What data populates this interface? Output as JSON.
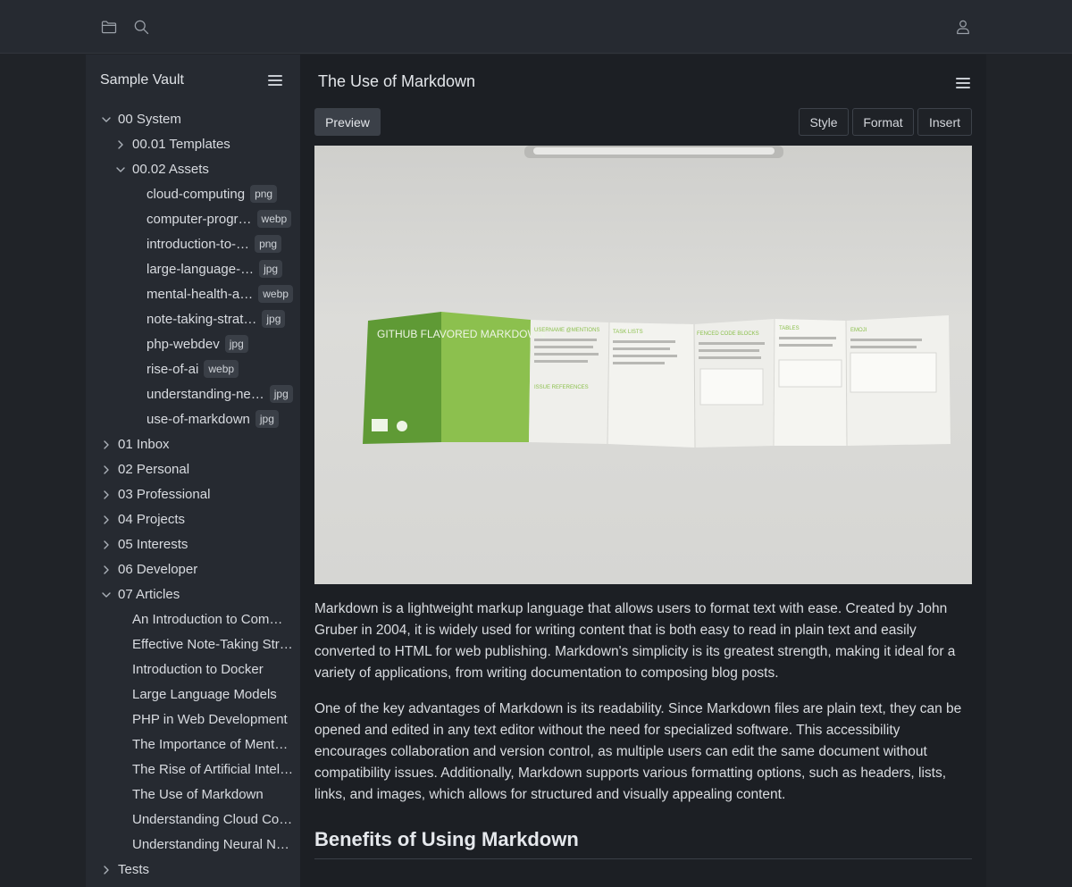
{
  "topbar": {
    "icons": [
      "folder-icon",
      "search-icon",
      "user-icon"
    ]
  },
  "sidebar": {
    "vault_name": "Sample Vault",
    "tree": [
      {
        "label": "00 System",
        "depth": 0,
        "folder": true,
        "open": true
      },
      {
        "label": "00.01 Templates",
        "depth": 1,
        "folder": true,
        "open": false
      },
      {
        "label": "00.02 Assets",
        "depth": 1,
        "folder": true,
        "open": true
      },
      {
        "label": "cloud-computing",
        "depth": 2,
        "badge": "png"
      },
      {
        "label": "computer-progr…",
        "depth": 2,
        "badge": "webp"
      },
      {
        "label": "introduction-to-…",
        "depth": 2,
        "badge": "png"
      },
      {
        "label": "large-language-…",
        "depth": 2,
        "badge": "jpg"
      },
      {
        "label": "mental-health-a…",
        "depth": 2,
        "badge": "webp"
      },
      {
        "label": "note-taking-strat…",
        "depth": 2,
        "badge": "jpg"
      },
      {
        "label": "php-webdev",
        "depth": 2,
        "badge": "jpg"
      },
      {
        "label": "rise-of-ai",
        "depth": 2,
        "badge": "webp"
      },
      {
        "label": "understanding-ne…",
        "depth": 2,
        "badge": "jpg"
      },
      {
        "label": "use-of-markdown",
        "depth": 2,
        "badge": "jpg"
      },
      {
        "label": "01 Inbox",
        "depth": 0,
        "folder": true,
        "open": false
      },
      {
        "label": "02 Personal",
        "depth": 0,
        "folder": true,
        "open": false
      },
      {
        "label": "03 Professional",
        "depth": 0,
        "folder": true,
        "open": false
      },
      {
        "label": "04 Projects",
        "depth": 0,
        "folder": true,
        "open": false
      },
      {
        "label": "05 Interests",
        "depth": 0,
        "folder": true,
        "open": false
      },
      {
        "label": "06 Developer",
        "depth": 0,
        "folder": true,
        "open": false
      },
      {
        "label": "07 Articles",
        "depth": 0,
        "folder": true,
        "open": true
      },
      {
        "label": "An Introduction to Com…",
        "depth": 1
      },
      {
        "label": "Effective Note-Taking Str…",
        "depth": 1
      },
      {
        "label": "Introduction to Docker",
        "depth": 1
      },
      {
        "label": "Large Language Models",
        "depth": 1
      },
      {
        "label": "PHP in Web Development",
        "depth": 1
      },
      {
        "label": "The Importance of Ment…",
        "depth": 1
      },
      {
        "label": "The Rise of Artificial Intel…",
        "depth": 1
      },
      {
        "label": "The Use of Markdown",
        "depth": 1
      },
      {
        "label": "Understanding Cloud Co…",
        "depth": 1
      },
      {
        "label": "Understanding Neural N…",
        "depth": 1
      },
      {
        "label": "Tests",
        "depth": 0,
        "folder": true,
        "open": false
      }
    ]
  },
  "main": {
    "title": "The Use of Markdown",
    "preview_label": "Preview",
    "style_label": "Style",
    "format_label": "Format",
    "insert_label": "Insert",
    "hero": {
      "front_title": "GITHUB FLAVORED MARKDOWN",
      "sections": [
        "USERNAME @MENTIONS",
        "TASK LISTS",
        "FENCED CODE BLOCKS",
        "TABLES",
        "EMOJI",
        "ISSUE REFERENCES"
      ]
    },
    "para1": "Markdown is a lightweight markup language that allows users to format text with ease. Created by John Gruber in 2004, it is widely used for writing content that is both easy to read in plain text and easily converted to HTML for web publishing. Markdown's simplicity is its greatest strength, making it ideal for a variety of applications, from writing documentation to composing blog posts.",
    "para2": "One of the key advantages of Markdown is its readability. Since Markdown files are plain text, they can be opened and edited in any text editor without the need for specialized software. This accessibility encourages collaboration and version control, as multiple users can edit the same document without compatibility issues. Additionally, Markdown supports various formatting options, such as headers, lists, links, and images, which allows for structured and visually appealing content.",
    "heading": "Benefits of Using Markdown"
  }
}
